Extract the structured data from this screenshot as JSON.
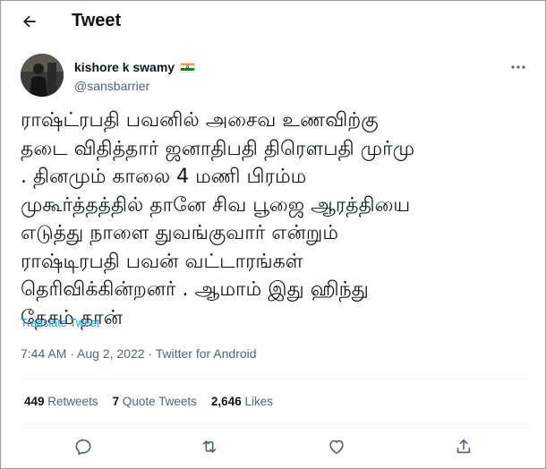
{
  "header": {
    "title": "Tweet",
    "back_icon": "arrow-left-icon"
  },
  "author": {
    "name": "kishore k swamy",
    "handle": "@sansbarrier",
    "flag_icon": "india-flag-icon",
    "avatar_icon": "profile-avatar"
  },
  "tweet": {
    "lines": [
      "ராஷ்ட்ரபதி பவனில் அசைவ உணவிற்கு",
      "தடை விதித்தார் ஜனாதிபதி திரௌபதி முர்மு",
      ". தினமும் காலை 4 மணி பிரம்ம",
      "முகூர்த்தத்தில் தானே சிவ பூஜை ஆரத்தியை",
      "எடுத்து நாளை துவங்குவார் என்றும்",
      "ராஷ்டிரபதி பவன் வட்டாரங்கள்",
      "தெரிவிக்கின்றனர் . ஆமாம் இது ஹிந்து",
      "தேசம் தான்"
    ],
    "translate_label": "Translate Tweet",
    "timestamp": "7:44 AM · Aug 2, 2022 · Twitter for Android"
  },
  "stats": {
    "retweets_count": "449",
    "retweets_label": "Retweets",
    "quotes_count": "7",
    "quotes_label": "Quote Tweets",
    "likes_count": "2,646",
    "likes_label": "Likes"
  },
  "actions": [
    "reply-icon",
    "retweet-icon",
    "like-icon",
    "share-icon"
  ],
  "colors": {
    "link": "#1d9bf0",
    "secondary": "#536471",
    "text": "#0f1419",
    "divider": "#eff3f4"
  }
}
